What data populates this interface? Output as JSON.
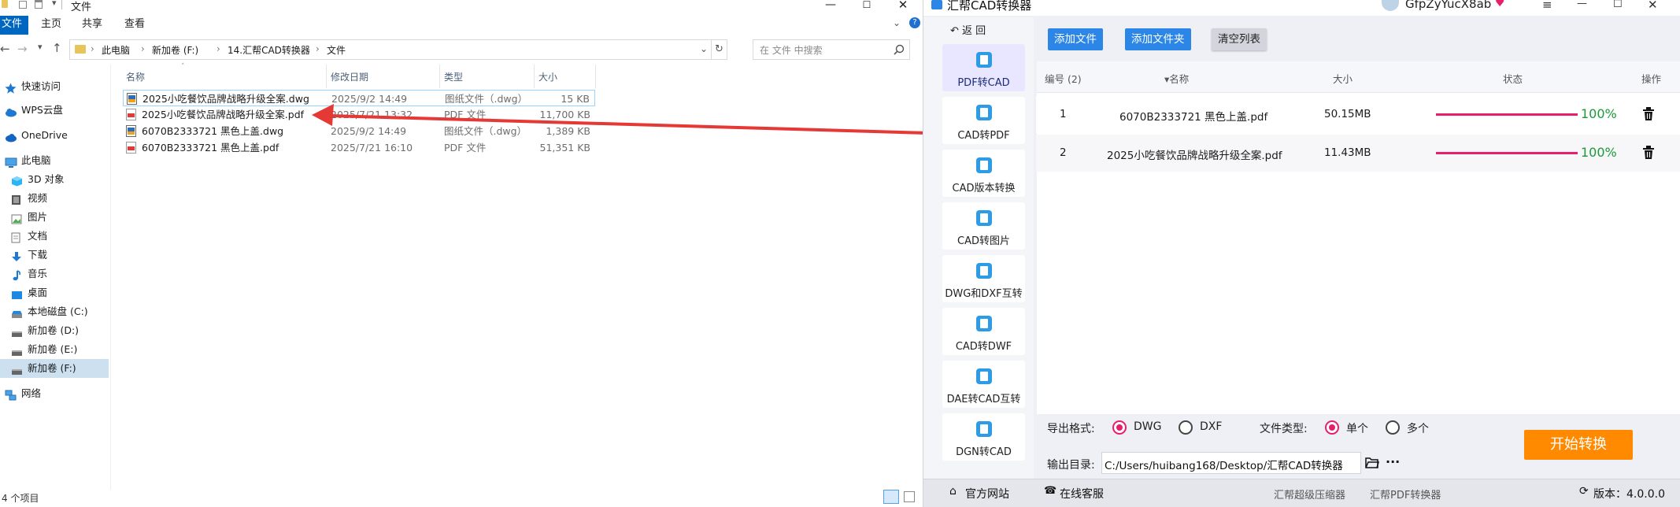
{
  "explorer": {
    "window_title": "文件",
    "ribbon_tabs": [
      "文件",
      "主页",
      "共享",
      "查看"
    ],
    "breadcrumb": [
      "此电脑",
      "新加卷 (F:)",
      "14.汇帮CAD转换器",
      "文件"
    ],
    "search_placeholder": "在 文件 中搜索",
    "nav": [
      "快速访问",
      "WPS云盘",
      "OneDrive",
      "此电脑",
      "3D 对象",
      "视频",
      "图片",
      "文档",
      "下载",
      "音乐",
      "桌面",
      "本地磁盘 (C:)",
      "新加卷 (D:)",
      "新加卷 (E:)",
      "新加卷 (F:)",
      "网络"
    ],
    "columns": [
      "名称",
      "修改日期",
      "类型",
      "大小"
    ],
    "files": [
      {
        "name": "2025小吃餐饮品牌战略升级全案.dwg",
        "date": "2025/9/2 14:49",
        "type": "图纸文件（.dwg）",
        "size": "15 KB",
        "icon": "dwg-file-icon"
      },
      {
        "name": "2025小吃餐饮品牌战略升级全案.pdf",
        "date": "2025/7/21 13:32",
        "type": "PDF 文件",
        "size": "11,700 KB",
        "icon": "pdf-file-icon"
      },
      {
        "name": "6070B2333721 黑色上盖.dwg",
        "date": "2025/9/2 14:49",
        "type": "图纸文件（.dwg）",
        "size": "1,389 KB",
        "icon": "dwg-file-icon"
      },
      {
        "name": "6070B2333721 黑色上盖.pdf",
        "date": "2025/7/21 16:10",
        "type": "PDF 文件",
        "size": "51,351 KB",
        "icon": "pdf-file-icon"
      }
    ],
    "status": "4 个项目",
    "colors": {
      "accent": "#0067c0",
      "selection": "#cce8ff",
      "arrow": "#e53935"
    }
  },
  "cad": {
    "title": "汇帮CAD转换器",
    "user": "GfpZyYucX8ab",
    "back_label": "返 回",
    "sidebar": [
      "PDF转CAD",
      "CAD转PDF",
      "CAD版本转换",
      "CAD转图片",
      "DWG和DXF互转",
      "CAD转DWF",
      "DAE转CAD互转",
      "DGN转CAD"
    ],
    "active_index": 0,
    "buttons": {
      "add_file": "添加文件",
      "add_folder": "添加文件夹",
      "clear": "清空列表",
      "start": "开始转换"
    },
    "table_headers": {
      "num": "编号 (2)",
      "name": "名称",
      "size": "大小",
      "status": "状态",
      "op": "操作"
    },
    "rows": [
      {
        "num": "1",
        "name": "6070B2333721 黑色上盖.pdf",
        "size": "50.15MB",
        "progress": 100,
        "pct": "100%"
      },
      {
        "num": "2",
        "name": "2025小吃餐饮品牌战略升级全案.pdf",
        "size": "11.43MB",
        "progress": 100,
        "pct": "100%"
      }
    ],
    "export_label": "导出格式:",
    "formats": [
      "DWG",
      "DXF"
    ],
    "format_selected": "DWG",
    "filetype_label": "文件类型:",
    "filetypes": [
      "单个",
      "多个"
    ],
    "filetype_selected": "单个",
    "output_label": "输出目录:",
    "output_path": "C:/Users/huibang168/Desktop/汇帮CAD转换器",
    "more_label": "···",
    "footer": {
      "site": "官方网站",
      "support": "在线客服",
      "link1": "汇帮超级压缩器",
      "link2": "汇帮PDF转换器",
      "version": "版本：4.0.0.0"
    },
    "colors": {
      "primary": "#2b86e8",
      "pink": "#e81e6a",
      "orange": "#ff8a00",
      "green": "#1a9a3a",
      "active_bg": "#e9e7ff"
    }
  }
}
